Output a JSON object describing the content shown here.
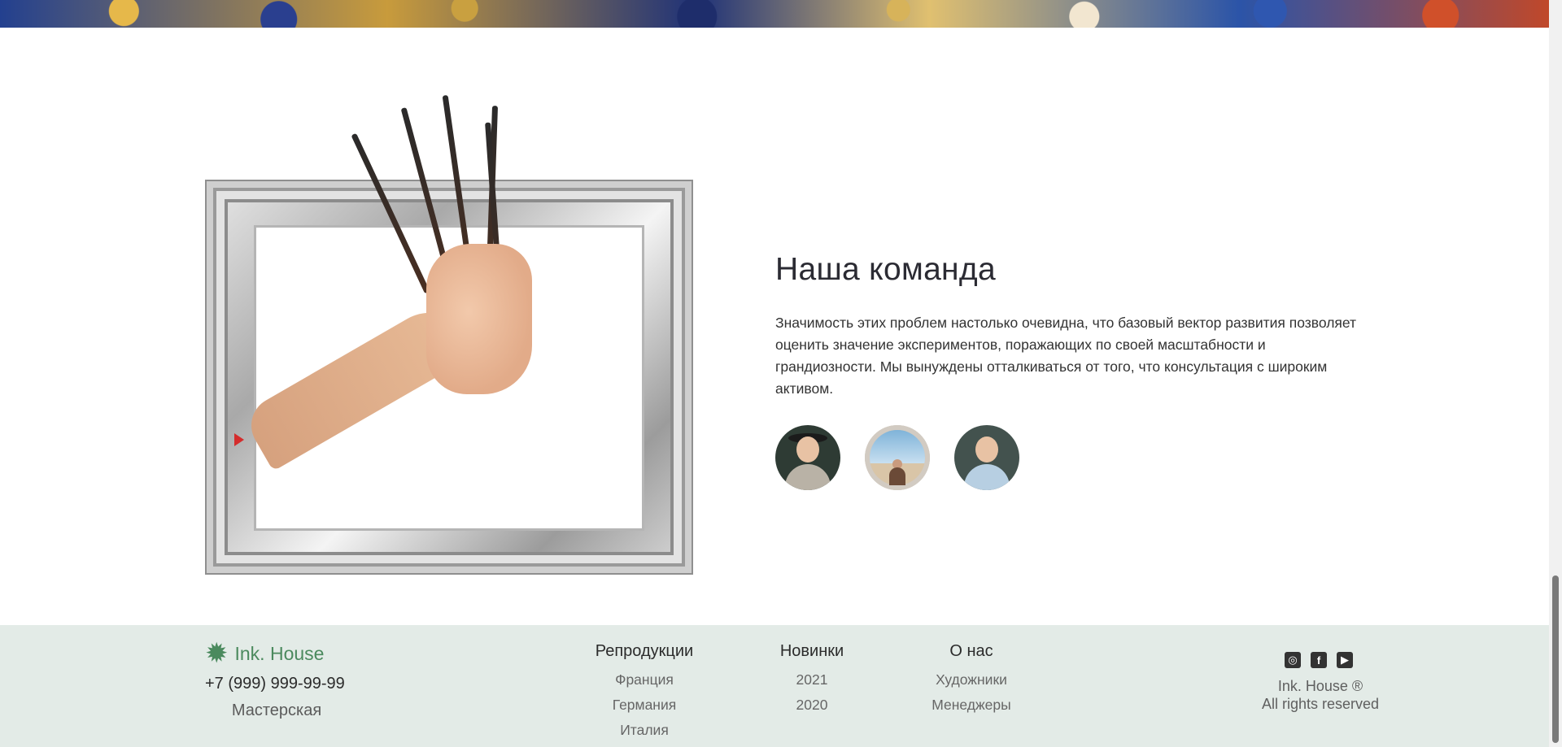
{
  "team": {
    "title": "Наша команда",
    "description": "Значимость этих проблем настолько очевидна, что базовый вектор развития позволяет оценить значение экспериментов, поражающих по своей масштабности и грандиозности. Мы вынуждены отталкиваться от того, что консультация с широким активом.",
    "members": [
      "avatar-woman-hat",
      "avatar-person-outdoor",
      "avatar-man-smiling"
    ]
  },
  "footer": {
    "logo_text": "Ink. House",
    "logo_icon": "starburst-icon",
    "phone": "+7 (999) 999-99-99",
    "workshop": "Мастерская",
    "columns": [
      {
        "heading": "Репродукции",
        "links": [
          "Франция",
          "Германия",
          "Италия"
        ]
      },
      {
        "heading": "Новинки",
        "links": [
          "2021",
          "2020"
        ]
      },
      {
        "heading": "О нас",
        "links": [
          "Художники",
          "Менеджеры"
        ]
      }
    ],
    "social": [
      "instagram-icon",
      "facebook-icon",
      "youtube-icon"
    ],
    "copyright_line1": "Ink. House ®",
    "copyright_line2": "All rights reserved"
  },
  "colors": {
    "accent": "#4b8a5e",
    "footer_bg": "#e3ebe7"
  }
}
